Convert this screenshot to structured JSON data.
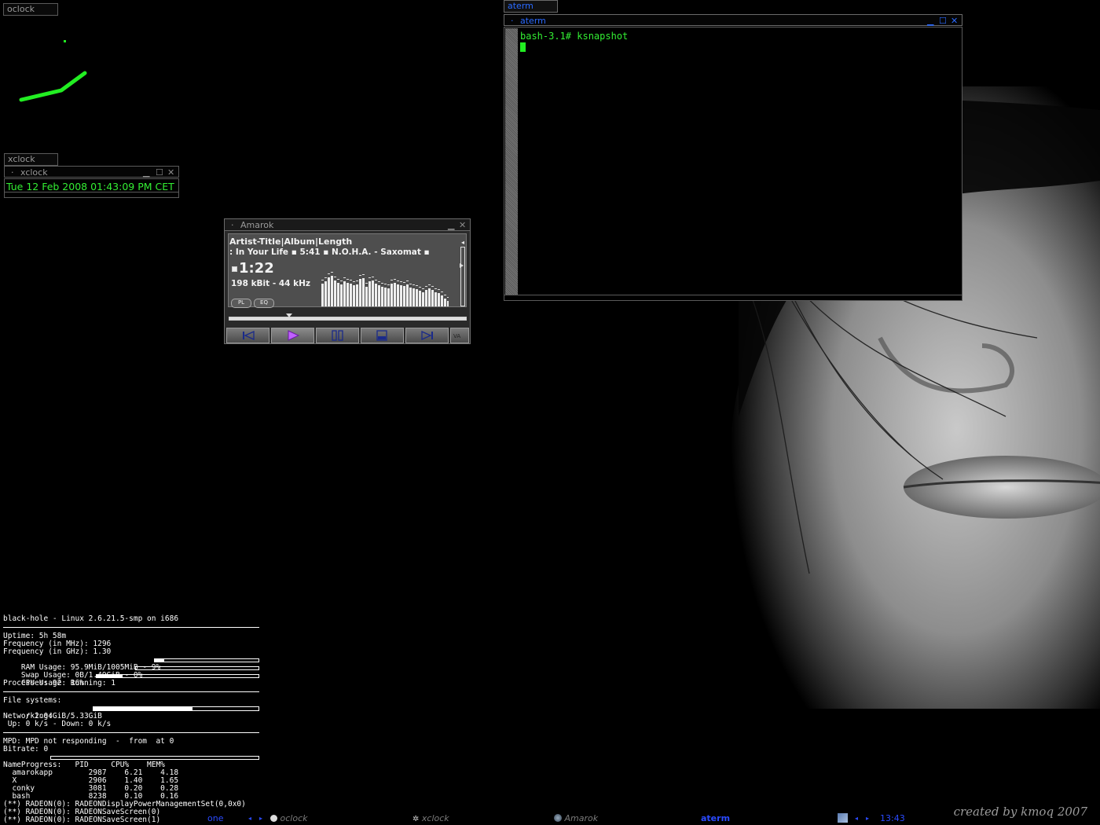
{
  "desktop": {
    "credit": "created by kmoq 2007"
  },
  "oclock": {
    "tab_label": "oclock"
  },
  "xclock": {
    "tab_label": "xclock",
    "title": "xclock",
    "time": "Tue 12 Feb 2008 01:43:09 PM CET"
  },
  "amarok": {
    "title": "Amarok",
    "header": "Artist-Title|Album|Length",
    "scroll_text": ": In Your Life  ▪  5:41  ▪  N.O.H.A. - Saxomat  ▪",
    "elapsed": "1:22",
    "bitrate": "198 kBit - 44 kHz",
    "pl_label": "PL",
    "eq_label": "EQ",
    "analyzer_levels": [
      0.62,
      0.7,
      0.8,
      0.85,
      0.72,
      0.65,
      0.6,
      0.7,
      0.66,
      0.62,
      0.58,
      0.6,
      0.75,
      0.78,
      0.55,
      0.7,
      0.72,
      0.64,
      0.58,
      0.55,
      0.52,
      0.5,
      0.62,
      0.65,
      0.6,
      0.58,
      0.56,
      0.6,
      0.52,
      0.5,
      0.48,
      0.44,
      0.4,
      0.46,
      0.5,
      0.45,
      0.4,
      0.38,
      0.3,
      0.22,
      0.15,
      0.08
    ],
    "seek_progress": 0.24
  },
  "aterm": {
    "tab_label": "aterm",
    "title": "aterm",
    "prompt": "bash-3.1# ksnapshot"
  },
  "conky": {
    "header": "black-hole - Linux 2.6.21.5-smp on i686",
    "uptime": "Uptime: 5h 58m",
    "freq_mhz": "Frequency (in MHz): 1296",
    "freq_ghz": "Frequency (in GHz): 1.30",
    "ram": "RAM Usage: 95.9MiB/1005MiB - 9%",
    "ram_pct": 0.09,
    "swap": "Swap Usage: 0B/1.49GiB - 0%",
    "swap_pct": 0.0,
    "cpu": "CPU Usage: 16%",
    "cpu_pct": 0.16,
    "processes": "Processes: 92  Running: 1",
    "fs_title": "File systems:",
    "fs_root": " / 2.04GiB/5.33GiB",
    "fs_pct": 0.6,
    "net_title": "Networking:",
    "net": " Up: 0 k/s - Down: 0 k/s",
    "mpd": "MPD: MPD not responding  -  from  at 0",
    "bitrate": "Bitrate: 0",
    "progress": "Progress:",
    "progress_pct": 0.0,
    "proc_header": "Name            PID     CPU%    MEM%",
    "procs": [
      "  amarokapp        2987    6.21    4.18",
      "  X                2906    1.40    1.65",
      "  conky            3081    0.20    0.28",
      "  bash             8238    0.10    0.16"
    ],
    "log": [
      "(**) RADEON(0): RADEONDisplayPowerManagementSet(0,0x0)",
      "(**) RADEON(0): RADEONSaveScreen(0)",
      "(**) RADEON(0): RADEONSaveScreen(1)"
    ]
  },
  "toolbar": {
    "workspace": "one",
    "left_arrow": "◂",
    "right_arrow": "▸",
    "items": [
      "oclock",
      "xclock",
      "Amarok",
      "aterm"
    ],
    "clock": "13:43"
  }
}
